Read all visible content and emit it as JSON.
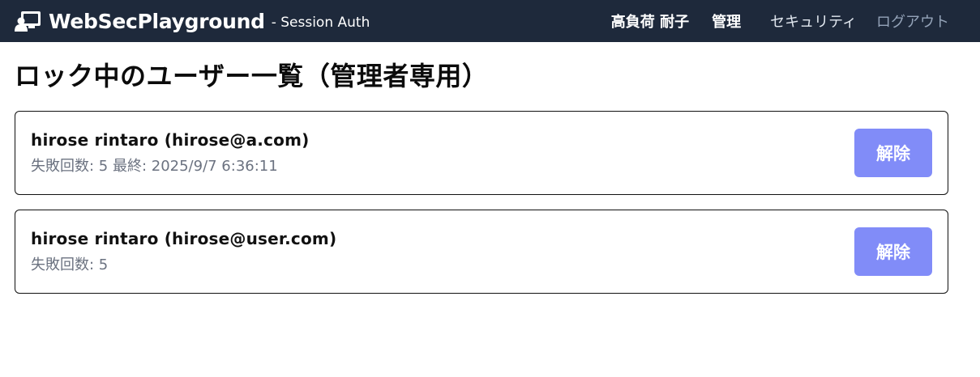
{
  "header": {
    "brand_icon": "presentation-user-icon",
    "brand_name": "WebSecPlayground",
    "brand_sub": "- Session Auth",
    "nav": {
      "user": "高負荷 耐子",
      "admin": "管理",
      "security": "セキュリティ",
      "logout": "ログアウト"
    },
    "background": "#1e293b"
  },
  "page": {
    "title": "ロック中のユーザー一覧（管理者専用）"
  },
  "locked_users": [
    {
      "user": "hirose rintaro (hirose@a.com)",
      "meta": "失敗回数: 5 最終: 2025/9/7 6:36:11",
      "button": "解除"
    },
    {
      "user": "hirose rintaro (hirose@user.com)",
      "meta": "失敗回数: 5",
      "button": "解除"
    }
  ],
  "colors": {
    "accent_button": "#818cf8",
    "meta_text": "#6b7280"
  }
}
